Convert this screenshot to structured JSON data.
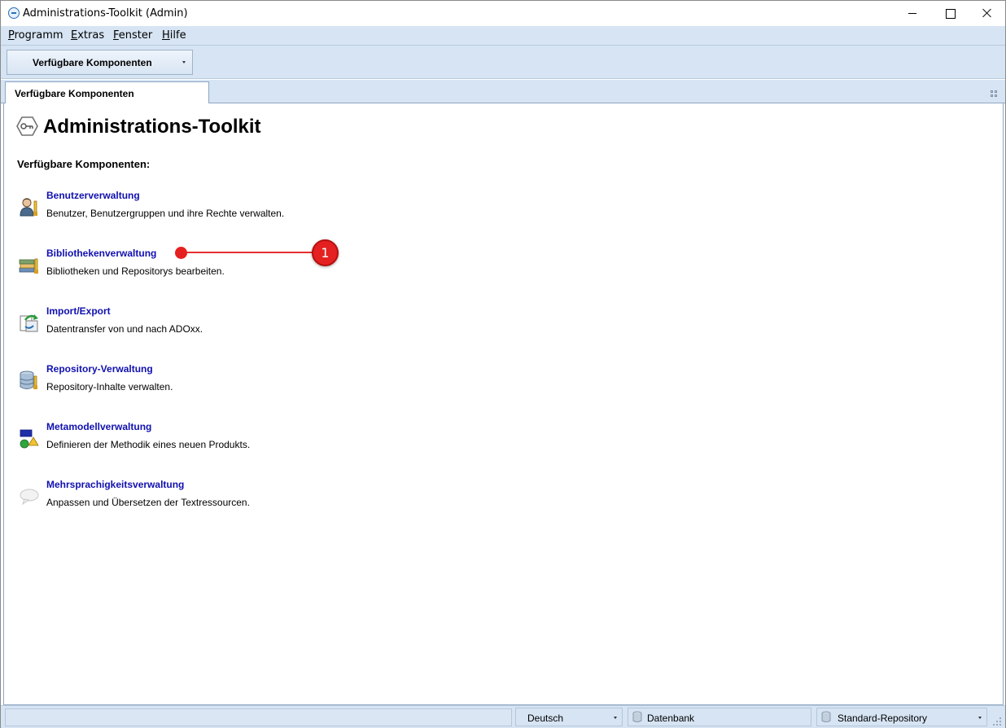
{
  "window": {
    "title": "Administrations-Toolkit (Admin)"
  },
  "menu": [
    {
      "label": "Programm",
      "underline": "P",
      "rest": "rogramm"
    },
    {
      "label": "Extras",
      "underline": "E",
      "rest": "xtras"
    },
    {
      "label": "Fenster",
      "underline": "F",
      "rest": "enster"
    },
    {
      "label": "Hilfe",
      "underline": "H",
      "rest": "ilfe"
    }
  ],
  "toolbar": {
    "dropdown_label": "Verfügbare Komponenten"
  },
  "tabs": [
    {
      "label": "Verfügbare Komponenten"
    }
  ],
  "main": {
    "title": "Administrations-Toolkit",
    "section_title": "Verfügbare Komponenten:",
    "components": [
      {
        "name": "Benutzerverwaltung",
        "description": "Benutzer, Benutzergruppen und ihre Rechte verwalten.",
        "icon": "user-admin-icon"
      },
      {
        "name": "Bibliothekenverwaltung",
        "description": "Bibliotheken und Repositorys bearbeiten.",
        "icon": "library-icon"
      },
      {
        "name": "Import/Export",
        "description": "Datentransfer von und nach ADOxx.",
        "icon": "import-export-icon"
      },
      {
        "name": "Repository-Verwaltung",
        "description": "Repository-Inhalte verwalten.",
        "icon": "repository-icon"
      },
      {
        "name": "Metamodellverwaltung",
        "description": "Definieren der Methodik eines neuen Produkts.",
        "icon": "metamodel-icon"
      },
      {
        "name": "Mehrsprachigkeitsverwaltung",
        "description": "Anpassen und Übersetzen der Textressourcen.",
        "icon": "speech-bubble-icon"
      }
    ]
  },
  "callout": {
    "number": "1",
    "color": "#e52020"
  },
  "statusbar": {
    "language": "Deutsch",
    "database": "Datenbank",
    "repository": "Standard-Repository"
  },
  "colors": {
    "chrome": "#d6e4f3",
    "link": "#1010b0"
  }
}
